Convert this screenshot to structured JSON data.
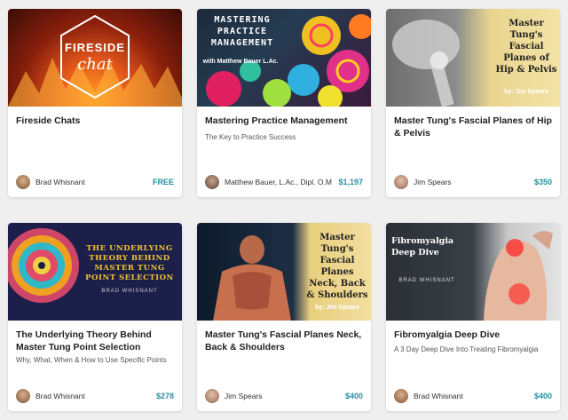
{
  "courses": [
    {
      "thumb_title": "FIRESIDE",
      "thumb_subtitle": "chat",
      "title": "Fireside Chats",
      "subtitle": "",
      "author": "Brad Whisnant",
      "price": "FREE"
    },
    {
      "thumb_title": "MASTERING PRACTICE MANAGEMENT",
      "thumb_subtitle": "with Matthew Bauer L.Ac.",
      "title": "Mastering Practice Management",
      "subtitle": "The Key to Practice Success",
      "author": "Matthew Bauer, L.Ac., Dipl. O.M",
      "price": "$1,197"
    },
    {
      "thumb_title": "Master Tung's Fascial Planes of Hip & Pelvis",
      "thumb_subtitle": "by: Jim Spears",
      "title": "Master Tung's Fascial Planes of Hip & Pelvis",
      "subtitle": "",
      "author": "Jim Spears",
      "price": "$350"
    },
    {
      "thumb_title": "THE UNDERLYING THEORY BEHIND MASTER TUNG POINT SELECTION",
      "thumb_subtitle": "BRAD WHISNANT",
      "title": "The Underlying Theory Behind Master Tung Point Selection",
      "subtitle": "Why, What, When & How to Use Specific Points",
      "author": "Brad Whisnant",
      "price": "$278"
    },
    {
      "thumb_title": "Master Tung's Fascial Planes Neck, Back & Shoulders",
      "thumb_subtitle": "by: Jim Spears",
      "title": "Master Tung's Fascial Planes Neck, Back & Shoulders",
      "subtitle": "",
      "author": "Jim Spears",
      "price": "$400"
    },
    {
      "thumb_title": "Fibromyalgia Deep Dive",
      "thumb_subtitle": "BRAD WHISNANT",
      "title": "Fibromyalgia Deep Dive",
      "subtitle": "A 3 Day Deep Dive Into Treating Fibromyalgia",
      "author": "Brad Whisnant",
      "price": "$400"
    }
  ],
  "colors": {
    "price": "#2a8fa0",
    "title": "#222222"
  }
}
